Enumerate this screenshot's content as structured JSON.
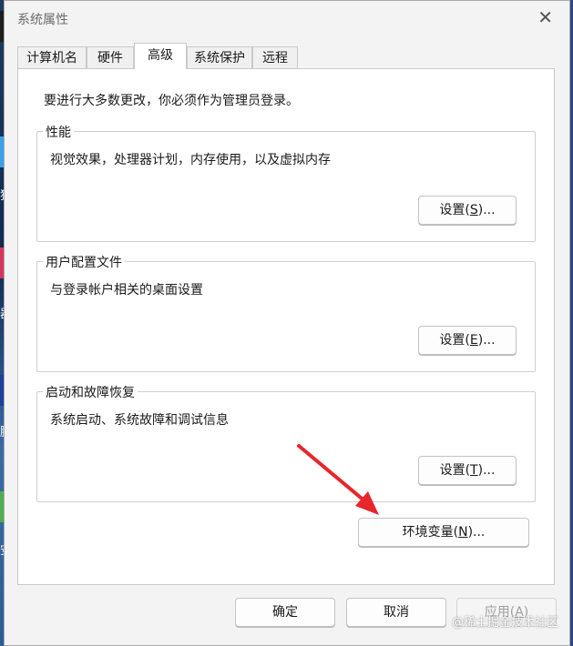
{
  "window": {
    "title": "系统属性",
    "close_glyph": "✕"
  },
  "tabs": [
    {
      "label": "计算机名"
    },
    {
      "label": "硬件"
    },
    {
      "label": "高级"
    },
    {
      "label": "系统保护"
    },
    {
      "label": "远程"
    }
  ],
  "active_tab": "高级",
  "panel": {
    "intro": "要进行大多数更改，你必须作为管理员登录。",
    "performance": {
      "legend": "性能",
      "desc": "视觉效果，处理器计划，内存使用，以及虚拟内存",
      "button_text": "设置(",
      "button_key": "S",
      "button_tail": ")..."
    },
    "profile": {
      "legend": "用户配置文件",
      "desc": "与登录帐户相关的桌面设置",
      "button_text": "设置(",
      "button_key": "E",
      "button_tail": ")..."
    },
    "startup": {
      "legend": "启动和故障恢复",
      "desc": "系统启动、系统故障和调试信息",
      "button_text": "设置(",
      "button_key": "T",
      "button_tail": ")..."
    },
    "env": {
      "button_text": "环境变量(",
      "button_key": "N",
      "button_tail": ")..."
    }
  },
  "footer": {
    "ok_label": "确定",
    "cancel_label": "取消",
    "apply_text": "应用(",
    "apply_key": "A",
    "apply_tail": ")"
  },
  "desktop_labels": [
    "猫",
    "器",
    "腿",
    "安"
  ],
  "watermark": "@稀土掘金技术社区",
  "colors": {
    "arrow": "#e8262b",
    "window_bg": "#f3f3f3",
    "panel_bg": "#ffffff"
  },
  "icons": [
    "close-icon",
    "red-arrow-annotation"
  ]
}
